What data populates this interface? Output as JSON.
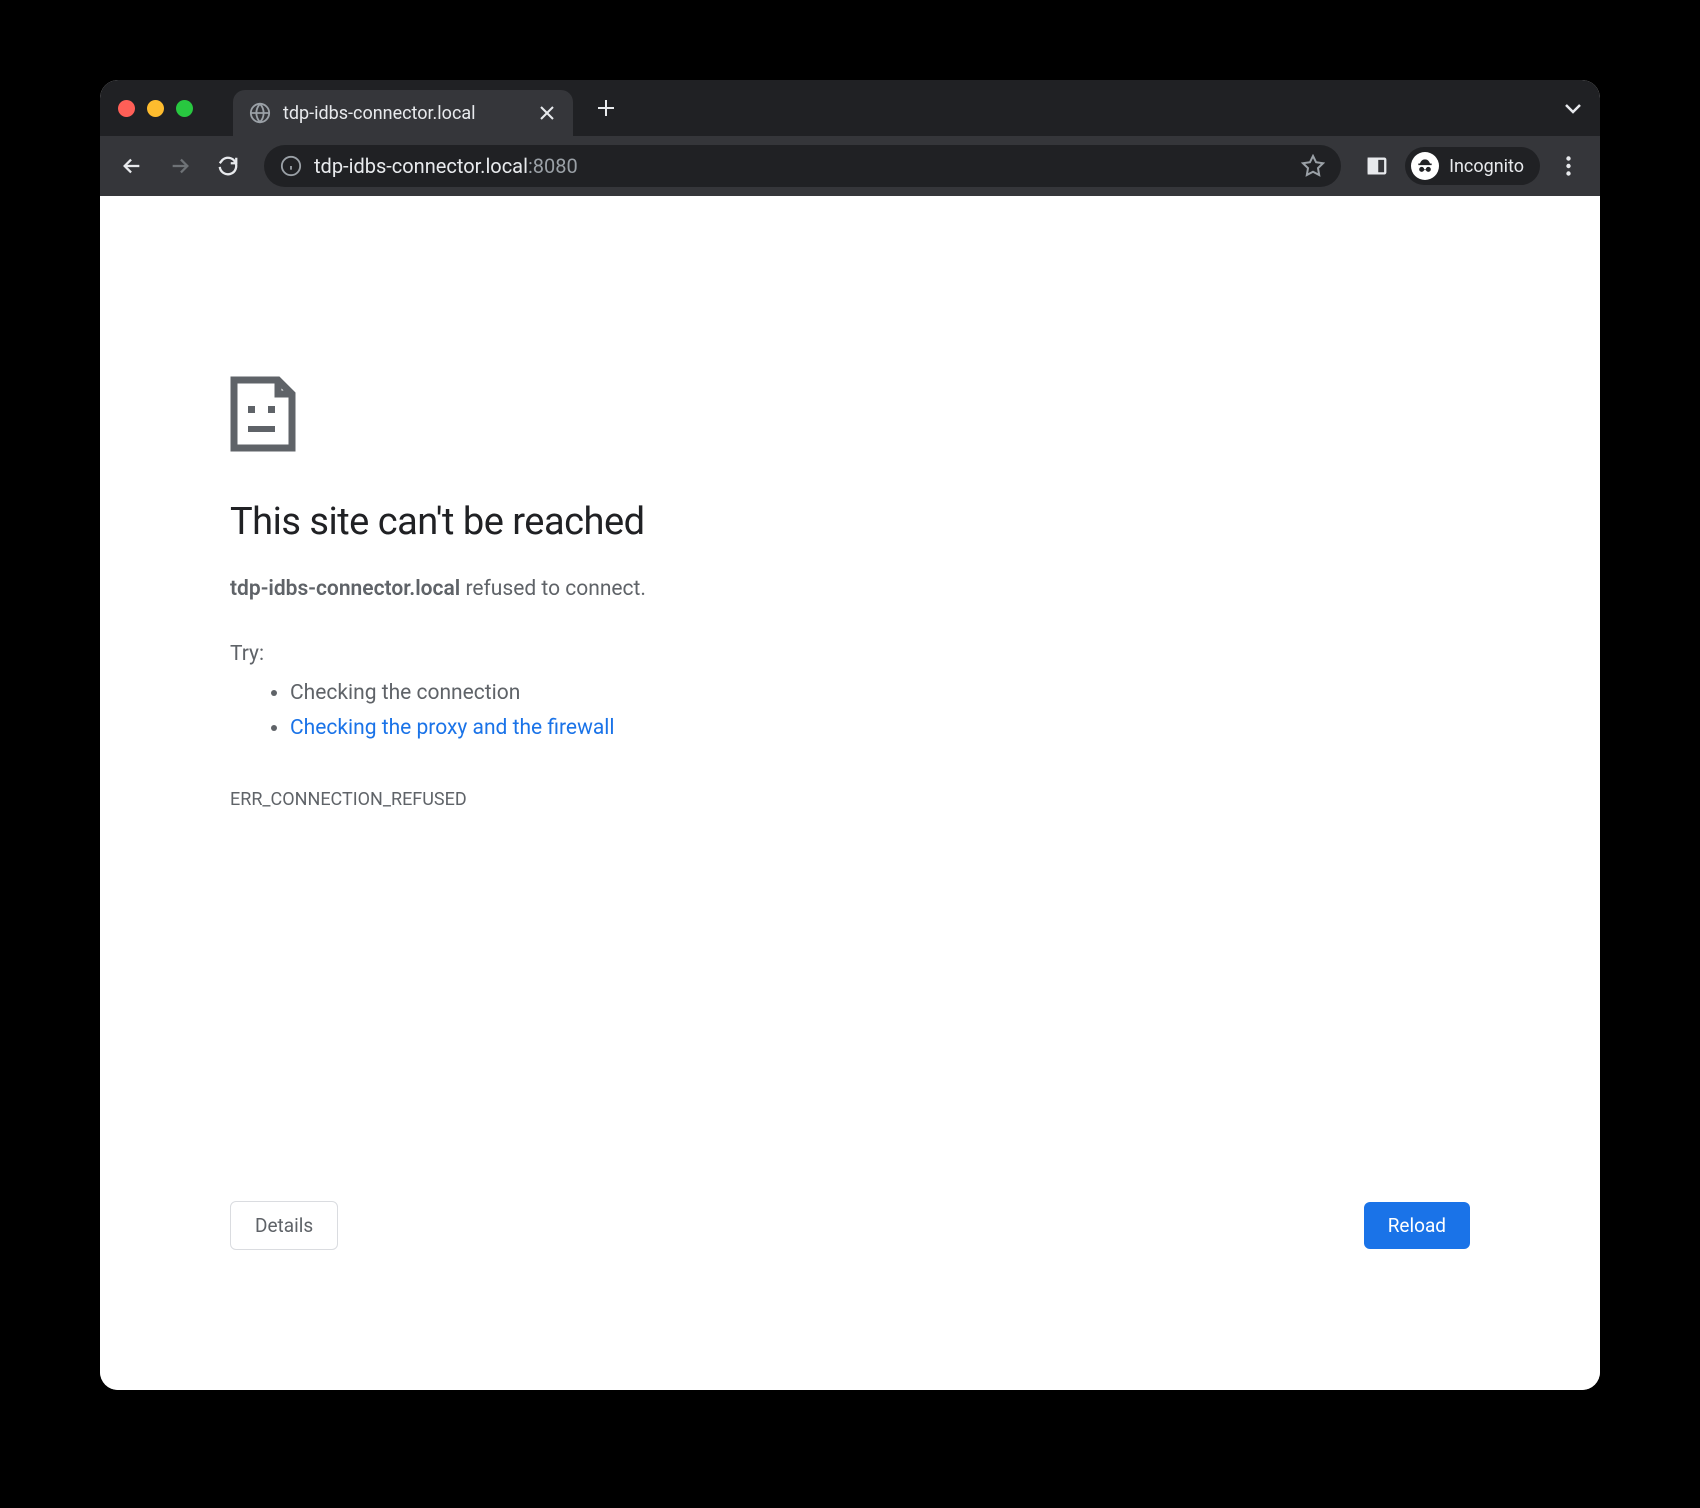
{
  "tab": {
    "title": "tdp-idbs-connector.local"
  },
  "address": {
    "host": "tdp-idbs-connector.local",
    "port": ":8080"
  },
  "incognito": {
    "label": "Incognito"
  },
  "error": {
    "title": "This site can't be reached",
    "host": "tdp-idbs-connector.local",
    "message_suffix": " refused to connect.",
    "try_label": "Try:",
    "suggestion1": "Checking the connection",
    "suggestion2": "Checking the proxy and the firewall",
    "code": "ERR_CONNECTION_REFUSED"
  },
  "buttons": {
    "details": "Details",
    "reload": "Reload"
  }
}
